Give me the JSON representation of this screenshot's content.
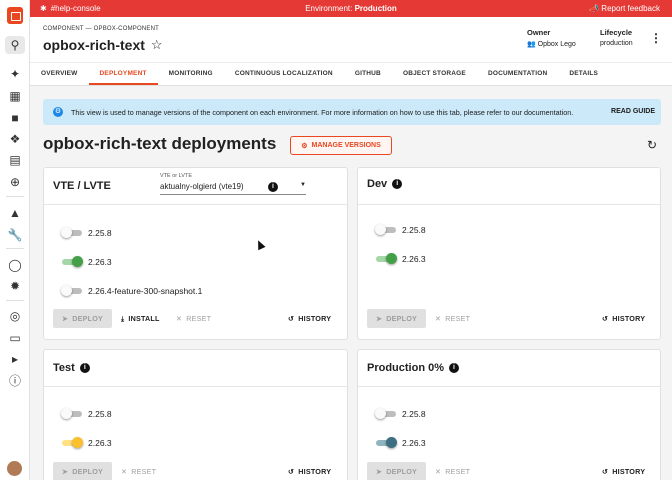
{
  "topbar": {
    "channel": "#help-console",
    "env_label": "Environment:",
    "env_value": "Production",
    "feedback": "Report feedback"
  },
  "header": {
    "breadcrumb": "COMPONENT — OPBOX-COMPONENT",
    "title": "opbox-rich-text",
    "owner_label": "Owner",
    "owner_value": "Opbox Lego",
    "lifecycle_label": "Lifecycle",
    "lifecycle_value": "production"
  },
  "tabs": [
    "OVERVIEW",
    "DEPLOYMENT",
    "MONITORING",
    "CONTINUOUS LOCALIZATION",
    "GITHUB",
    "OBJECT STORAGE",
    "DOCUMENTATION",
    "DETAILS"
  ],
  "active_tab": "DEPLOYMENT",
  "banner": {
    "text": "This view is used to manage versions of the component on each environment. For more information on how to use this tab, please refer to our documentation.",
    "action": "READ GUIDE"
  },
  "section": {
    "title": "opbox-rich-text deployments",
    "manage_label": "MANAGE VERSIONS"
  },
  "cards": {
    "vte": {
      "title": "VTE / LVTE",
      "select_label": "VTE or LVTE",
      "select_value": "aktualny-olgierd (vte19)",
      "versions": [
        "2.25.8",
        "2.26.3",
        "2.26.4-feature-300-snapshot.1"
      ],
      "deploy": "DEPLOY",
      "install": "INSTALL",
      "reset": "RESET",
      "history": "HISTORY"
    },
    "dev": {
      "title": "Dev",
      "versions": [
        "2.25.8",
        "2.26.3"
      ],
      "deploy": "DEPLOY",
      "reset": "RESET",
      "history": "HISTORY"
    },
    "test": {
      "title": "Test",
      "versions": [
        "2.25.8",
        "2.26.3"
      ],
      "deploy": "DEPLOY",
      "reset": "RESET",
      "history": "HISTORY"
    },
    "prod": {
      "title": "Production 0%",
      "versions": [
        "2.25.8",
        "2.26.3"
      ],
      "deploy": "DEPLOY",
      "reset": "RESET",
      "history": "HISTORY"
    }
  },
  "colors": {
    "accent": "#e8471f",
    "topbar": "#e53935",
    "banner": "#cce9f9",
    "switch_vte_dev": "#43a047",
    "switch_test": "#fbc02d",
    "switch_prod": "#3d6f80"
  },
  "icons": [
    "logo-icon",
    "search-icon",
    "sparkle-icon",
    "dashboard-icon",
    "folder-icon",
    "network-icon",
    "book-icon",
    "add-circle-icon",
    "wolf-icon",
    "wrench-icon",
    "lightbulb-icon",
    "satellite-icon",
    "target-icon",
    "laptop-icon",
    "megaphone-icon",
    "info-icon",
    "star-icon",
    "kebab-icon",
    "gear-icon",
    "refresh-icon",
    "rocket-icon",
    "download-icon",
    "close-icon",
    "history-icon"
  ]
}
